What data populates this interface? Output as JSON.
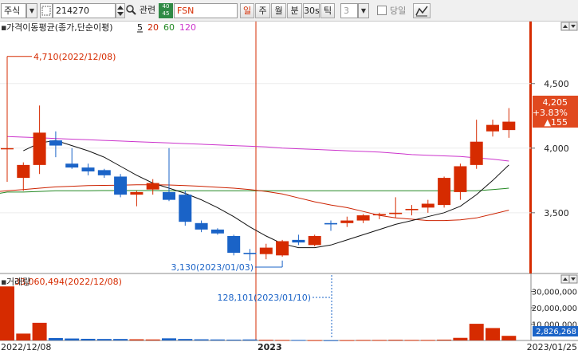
{
  "toolbar": {
    "market_select": "주식",
    "code_input": "214270",
    "related_label": "관련",
    "badge_text": "40 45",
    "stock_name": "FSN",
    "period_tabs": [
      "일",
      "주",
      "월",
      "분",
      "30s",
      "틱"
    ],
    "active_tab": "일",
    "interval_value": "3",
    "today_checkbox_label": "당일",
    "icons": [
      "chevron-down-icon",
      "dashed-box-icon",
      "spin-updown-icon",
      "search-icon",
      "chart-tool-icon"
    ]
  },
  "price_panel": {
    "indicator_title": "가격이동평균(종가,단순이평)",
    "ma_periods": [
      {
        "label": "5",
        "color": "#111111"
      },
      {
        "label": "20",
        "color": "#cc2200"
      },
      {
        "label": "60",
        "color": "#228822"
      },
      {
        "label": "120",
        "color": "#cc33cc"
      }
    ],
    "max_annotation": "4,710(2022/12/08)",
    "min_annotation": "3,130(2023/01/03)",
    "current_price": "4,205",
    "change_pct": "+3.83%",
    "change_amt": "▲155",
    "y_ticks": [
      "4,500",
      "4,000",
      "3,500"
    ]
  },
  "volume_panel": {
    "title": "거래량",
    "max_annotation": "33,060,494(2022/12/08)",
    "min_annotation": "128,101(2023/01/10)",
    "current_volume": "2,826,268",
    "y_ticks": [
      "30,000,000",
      "20,000,000",
      "10,000,000"
    ]
  },
  "x_axis": {
    "start_date": "2022/12/08",
    "year_label": "2023",
    "end_date": "2023/01/25"
  },
  "colors": {
    "up": "#d62b00",
    "down": "#1a63c7",
    "ma5": "#111111",
    "ma20": "#cc2200",
    "ma60": "#228822",
    "ma120": "#cc33cc",
    "price_box": "#e0491f"
  },
  "chart_data": {
    "type": "candlestick",
    "dates": [
      "2022/12/08",
      "2022/12/09",
      "2022/12/12",
      "2022/12/13",
      "2022/12/14",
      "2022/12/15",
      "2022/12/16",
      "2022/12/19",
      "2022/12/20",
      "2022/12/21",
      "2022/12/22",
      "2022/12/23",
      "2022/12/26",
      "2022/12/27",
      "2022/12/28",
      "2022/12/29",
      "2023/01/02",
      "2023/01/03",
      "2023/01/04",
      "2023/01/05",
      "2023/01/06",
      "2023/01/09",
      "2023/01/10",
      "2023/01/11",
      "2023/01/12",
      "2023/01/13",
      "2023/01/16",
      "2023/01/17",
      "2023/01/18",
      "2023/01/19",
      "2023/01/20",
      "2023/01/25"
    ],
    "candles": [
      {
        "o": 4000,
        "h": 4710,
        "l": 3740,
        "c": 4000
      },
      {
        "o": 3770,
        "h": 3890,
        "l": 3670,
        "c": 3870
      },
      {
        "o": 3870,
        "h": 4330,
        "l": 3800,
        "c": 4120
      },
      {
        "o": 4060,
        "h": 4130,
        "l": 3930,
        "c": 4020
      },
      {
        "o": 3880,
        "h": 4000,
        "l": 3840,
        "c": 3850
      },
      {
        "o": 3850,
        "h": 3880,
        "l": 3790,
        "c": 3820
      },
      {
        "o": 3830,
        "h": 3840,
        "l": 3770,
        "c": 3790
      },
      {
        "o": 3780,
        "h": 3800,
        "l": 3620,
        "c": 3640
      },
      {
        "o": 3640,
        "h": 3670,
        "l": 3550,
        "c": 3660
      },
      {
        "o": 3680,
        "h": 3760,
        "l": 3640,
        "c": 3730
      },
      {
        "o": 3660,
        "h": 4000,
        "l": 3590,
        "c": 3600
      },
      {
        "o": 3640,
        "h": 3670,
        "l": 3400,
        "c": 3430
      },
      {
        "o": 3420,
        "h": 3440,
        "l": 3350,
        "c": 3370
      },
      {
        "o": 3370,
        "h": 3380,
        "l": 3330,
        "c": 3340
      },
      {
        "o": 3320,
        "h": 3330,
        "l": 3170,
        "c": 3190
      },
      {
        "o": 3190,
        "h": 3220,
        "l": 3130,
        "c": 3180
      },
      {
        "o": 3180,
        "h": 3260,
        "l": 3140,
        "c": 3230
      },
      {
        "o": 3170,
        "h": 3290,
        "l": 3160,
        "c": 3280
      },
      {
        "o": 3290,
        "h": 3330,
        "l": 3250,
        "c": 3270
      },
      {
        "o": 3250,
        "h": 3330,
        "l": 3240,
        "c": 3320
      },
      {
        "o": 3420,
        "h": 3440,
        "l": 3360,
        "c": 3410
      },
      {
        "o": 3420,
        "h": 3470,
        "l": 3390,
        "c": 3440
      },
      {
        "o": 3440,
        "h": 3490,
        "l": 3420,
        "c": 3480
      },
      {
        "o": 3480,
        "h": 3500,
        "l": 3450,
        "c": 3490
      },
      {
        "o": 3490,
        "h": 3620,
        "l": 3460,
        "c": 3500
      },
      {
        "o": 3520,
        "h": 3560,
        "l": 3480,
        "c": 3530
      },
      {
        "o": 3540,
        "h": 3600,
        "l": 3500,
        "c": 3570
      },
      {
        "o": 3560,
        "h": 3780,
        "l": 3540,
        "c": 3770
      },
      {
        "o": 3660,
        "h": 3880,
        "l": 3600,
        "c": 3860
      },
      {
        "o": 3870,
        "h": 4220,
        "l": 3840,
        "c": 4050
      },
      {
        "o": 4130,
        "h": 4220,
        "l": 4090,
        "c": 4180
      },
      {
        "o": 4140,
        "h": 4310,
        "l": 4080,
        "c": 4205
      }
    ],
    "ma5": [
      3980,
      4040,
      4060,
      4020,
      3980,
      3930,
      3860,
      3790,
      3730,
      3690,
      3650,
      3600,
      3540,
      3470,
      3390,
      3320,
      3260,
      3230,
      3230,
      3250,
      3290,
      3330,
      3370,
      3410,
      3440,
      3470,
      3500,
      3550,
      3640,
      3750,
      3870
    ],
    "ma20": [
      3660,
      3670,
      3680,
      3690,
      3700,
      3705,
      3710,
      3712,
      3714,
      3716,
      3717,
      3715,
      3710,
      3705,
      3697,
      3690,
      3680,
      3665,
      3645,
      3615,
      3585,
      3560,
      3540,
      3510,
      3480,
      3460,
      3450,
      3440,
      3440,
      3445,
      3460,
      3490,
      3520
    ],
    "ma60": [
      3640,
      3660,
      3660,
      3665,
      3670,
      3670,
      3670,
      3672,
      3672,
      3672,
      3672,
      3670,
      3670,
      3670,
      3670,
      3670,
      3670,
      3670,
      3670,
      3670,
      3670,
      3670,
      3670,
      3670,
      3670,
      3670,
      3670,
      3670,
      3670,
      3670,
      3670,
      3680,
      3690
    ],
    "ma120": [
      4090,
      4085,
      4080,
      4075,
      4070,
      4065,
      4060,
      4055,
      4050,
      4045,
      4040,
      4035,
      4030,
      4025,
      4020,
      4015,
      4010,
      4000,
      3995,
      3990,
      3985,
      3980,
      3975,
      3970,
      3960,
      3950,
      3945,
      3940,
      3935,
      3925,
      3915,
      3900
    ],
    "volumes": [
      33060494,
      4200000,
      10800000,
      1500000,
      1200000,
      1000000,
      900000,
      900000,
      700000,
      600000,
      1300000,
      900000,
      700000,
      600000,
      500000,
      600000,
      400000,
      300000,
      300000,
      200000,
      128101,
      200000,
      300000,
      300000,
      400000,
      300000,
      300000,
      500000,
      1600000,
      10200000,
      7600000,
      2826268
    ],
    "price_ylim": [
      3030,
      4980
    ],
    "volume_ylim": [
      0,
      40000000
    ],
    "ylabel": "",
    "xlabel": ""
  }
}
